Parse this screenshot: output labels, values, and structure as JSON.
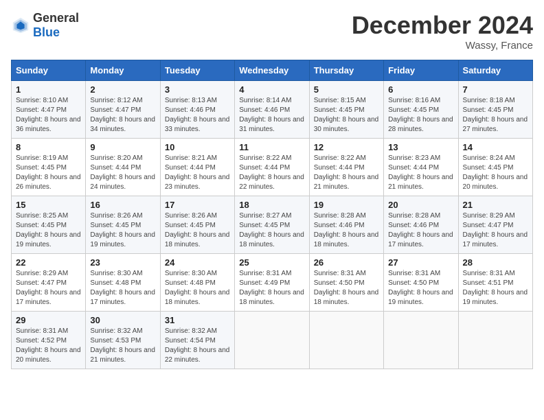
{
  "logo": {
    "text_general": "General",
    "text_blue": "Blue"
  },
  "title": "December 2024",
  "location": "Wassy, France",
  "days_of_week": [
    "Sunday",
    "Monday",
    "Tuesday",
    "Wednesday",
    "Thursday",
    "Friday",
    "Saturday"
  ],
  "weeks": [
    [
      {
        "day": "1",
        "sunrise": "Sunrise: 8:10 AM",
        "sunset": "Sunset: 4:47 PM",
        "daylight": "Daylight: 8 hours and 36 minutes."
      },
      {
        "day": "2",
        "sunrise": "Sunrise: 8:12 AM",
        "sunset": "Sunset: 4:47 PM",
        "daylight": "Daylight: 8 hours and 34 minutes."
      },
      {
        "day": "3",
        "sunrise": "Sunrise: 8:13 AM",
        "sunset": "Sunset: 4:46 PM",
        "daylight": "Daylight: 8 hours and 33 minutes."
      },
      {
        "day": "4",
        "sunrise": "Sunrise: 8:14 AM",
        "sunset": "Sunset: 4:46 PM",
        "daylight": "Daylight: 8 hours and 31 minutes."
      },
      {
        "day": "5",
        "sunrise": "Sunrise: 8:15 AM",
        "sunset": "Sunset: 4:45 PM",
        "daylight": "Daylight: 8 hours and 30 minutes."
      },
      {
        "day": "6",
        "sunrise": "Sunrise: 8:16 AM",
        "sunset": "Sunset: 4:45 PM",
        "daylight": "Daylight: 8 hours and 28 minutes."
      },
      {
        "day": "7",
        "sunrise": "Sunrise: 8:18 AM",
        "sunset": "Sunset: 4:45 PM",
        "daylight": "Daylight: 8 hours and 27 minutes."
      }
    ],
    [
      {
        "day": "8",
        "sunrise": "Sunrise: 8:19 AM",
        "sunset": "Sunset: 4:45 PM",
        "daylight": "Daylight: 8 hours and 26 minutes."
      },
      {
        "day": "9",
        "sunrise": "Sunrise: 8:20 AM",
        "sunset": "Sunset: 4:44 PM",
        "daylight": "Daylight: 8 hours and 24 minutes."
      },
      {
        "day": "10",
        "sunrise": "Sunrise: 8:21 AM",
        "sunset": "Sunset: 4:44 PM",
        "daylight": "Daylight: 8 hours and 23 minutes."
      },
      {
        "day": "11",
        "sunrise": "Sunrise: 8:22 AM",
        "sunset": "Sunset: 4:44 PM",
        "daylight": "Daylight: 8 hours and 22 minutes."
      },
      {
        "day": "12",
        "sunrise": "Sunrise: 8:22 AM",
        "sunset": "Sunset: 4:44 PM",
        "daylight": "Daylight: 8 hours and 21 minutes."
      },
      {
        "day": "13",
        "sunrise": "Sunrise: 8:23 AM",
        "sunset": "Sunset: 4:44 PM",
        "daylight": "Daylight: 8 hours and 21 minutes."
      },
      {
        "day": "14",
        "sunrise": "Sunrise: 8:24 AM",
        "sunset": "Sunset: 4:45 PM",
        "daylight": "Daylight: 8 hours and 20 minutes."
      }
    ],
    [
      {
        "day": "15",
        "sunrise": "Sunrise: 8:25 AM",
        "sunset": "Sunset: 4:45 PM",
        "daylight": "Daylight: 8 hours and 19 minutes."
      },
      {
        "day": "16",
        "sunrise": "Sunrise: 8:26 AM",
        "sunset": "Sunset: 4:45 PM",
        "daylight": "Daylight: 8 hours and 19 minutes."
      },
      {
        "day": "17",
        "sunrise": "Sunrise: 8:26 AM",
        "sunset": "Sunset: 4:45 PM",
        "daylight": "Daylight: 8 hours and 18 minutes."
      },
      {
        "day": "18",
        "sunrise": "Sunrise: 8:27 AM",
        "sunset": "Sunset: 4:45 PM",
        "daylight": "Daylight: 8 hours and 18 minutes."
      },
      {
        "day": "19",
        "sunrise": "Sunrise: 8:28 AM",
        "sunset": "Sunset: 4:46 PM",
        "daylight": "Daylight: 8 hours and 18 minutes."
      },
      {
        "day": "20",
        "sunrise": "Sunrise: 8:28 AM",
        "sunset": "Sunset: 4:46 PM",
        "daylight": "Daylight: 8 hours and 17 minutes."
      },
      {
        "day": "21",
        "sunrise": "Sunrise: 8:29 AM",
        "sunset": "Sunset: 4:47 PM",
        "daylight": "Daylight: 8 hours and 17 minutes."
      }
    ],
    [
      {
        "day": "22",
        "sunrise": "Sunrise: 8:29 AM",
        "sunset": "Sunset: 4:47 PM",
        "daylight": "Daylight: 8 hours and 17 minutes."
      },
      {
        "day": "23",
        "sunrise": "Sunrise: 8:30 AM",
        "sunset": "Sunset: 4:48 PM",
        "daylight": "Daylight: 8 hours and 17 minutes."
      },
      {
        "day": "24",
        "sunrise": "Sunrise: 8:30 AM",
        "sunset": "Sunset: 4:48 PM",
        "daylight": "Daylight: 8 hours and 18 minutes."
      },
      {
        "day": "25",
        "sunrise": "Sunrise: 8:31 AM",
        "sunset": "Sunset: 4:49 PM",
        "daylight": "Daylight: 8 hours and 18 minutes."
      },
      {
        "day": "26",
        "sunrise": "Sunrise: 8:31 AM",
        "sunset": "Sunset: 4:50 PM",
        "daylight": "Daylight: 8 hours and 18 minutes."
      },
      {
        "day": "27",
        "sunrise": "Sunrise: 8:31 AM",
        "sunset": "Sunset: 4:50 PM",
        "daylight": "Daylight: 8 hours and 19 minutes."
      },
      {
        "day": "28",
        "sunrise": "Sunrise: 8:31 AM",
        "sunset": "Sunset: 4:51 PM",
        "daylight": "Daylight: 8 hours and 19 minutes."
      }
    ],
    [
      {
        "day": "29",
        "sunrise": "Sunrise: 8:31 AM",
        "sunset": "Sunset: 4:52 PM",
        "daylight": "Daylight: 8 hours and 20 minutes."
      },
      {
        "day": "30",
        "sunrise": "Sunrise: 8:32 AM",
        "sunset": "Sunset: 4:53 PM",
        "daylight": "Daylight: 8 hours and 21 minutes."
      },
      {
        "day": "31",
        "sunrise": "Sunrise: 8:32 AM",
        "sunset": "Sunset: 4:54 PM",
        "daylight": "Daylight: 8 hours and 22 minutes."
      },
      null,
      null,
      null,
      null
    ]
  ]
}
